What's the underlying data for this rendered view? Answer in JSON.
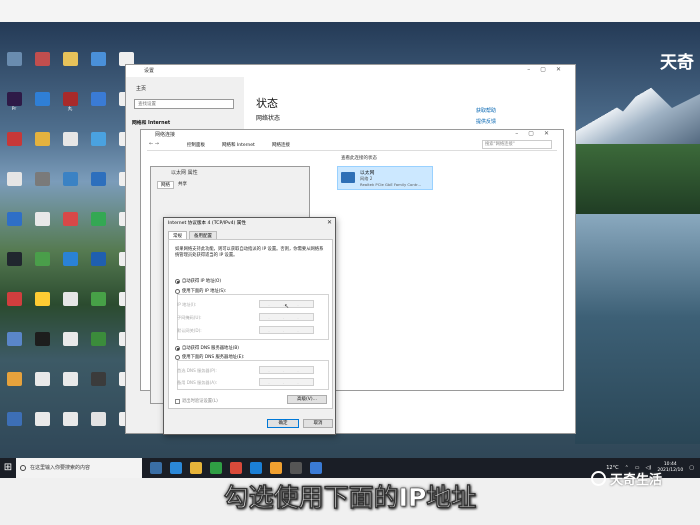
{
  "brand": {
    "top_right": "天奇",
    "bottom_right": "天奇生活"
  },
  "subtitle": "勾选使用下面的IP地址",
  "desktop_icons": [
    {
      "label": "",
      "color": "#6a8caf"
    },
    {
      "label": "",
      "color": "#c14e4e"
    },
    {
      "label": "",
      "color": "#e7c25a"
    },
    {
      "label": "",
      "color": "#4a90d9"
    },
    {
      "label": "",
      "color": "#efefef"
    },
    {
      "label": "Pr",
      "color": "#2e1a47"
    },
    {
      "label": "",
      "color": "#2f7fd6"
    },
    {
      "label": "丸",
      "color": "#a82a2a"
    },
    {
      "label": "",
      "color": "#3a7bd5"
    },
    {
      "label": "",
      "color": "#efefef"
    },
    {
      "label": "",
      "color": "#c73838"
    },
    {
      "label": "",
      "color": "#e4b23e"
    },
    {
      "label": "",
      "color": "#e6e6e6"
    },
    {
      "label": "",
      "color": "#4aa2e0"
    },
    {
      "label": "",
      "color": "#efefef"
    },
    {
      "label": "",
      "color": "#e5e5e5"
    },
    {
      "label": "",
      "color": "#7a7a7a"
    },
    {
      "label": "",
      "color": "#3b82c4"
    },
    {
      "label": "",
      "color": "#2d6fbd"
    },
    {
      "label": "",
      "color": "#efefef"
    },
    {
      "label": "",
      "color": "#2f6fc7"
    },
    {
      "label": "",
      "color": "#e8e8e8"
    },
    {
      "label": "",
      "color": "#d94848"
    },
    {
      "label": "",
      "color": "#34a853"
    },
    {
      "label": "",
      "color": "#efefef"
    },
    {
      "label": "",
      "color": "#20262e"
    },
    {
      "label": "",
      "color": "#4a9e4a"
    },
    {
      "label": "",
      "color": "#2a82d6"
    },
    {
      "label": "",
      "color": "#1f5fb0"
    },
    {
      "label": "",
      "color": "#efefef"
    },
    {
      "label": "",
      "color": "#d13e3e"
    },
    {
      "label": "",
      "color": "#ffcc33"
    },
    {
      "label": "",
      "color": "#e6e6e6"
    },
    {
      "label": "",
      "color": "#47a147"
    },
    {
      "label": "",
      "color": "#efefef"
    },
    {
      "label": "",
      "color": "#5a86c9"
    },
    {
      "label": "",
      "color": "#1d1d1d"
    },
    {
      "label": "",
      "color": "#e9e9e9"
    },
    {
      "label": "",
      "color": "#3b8c3b"
    },
    {
      "label": "",
      "color": "#efefef"
    },
    {
      "label": "",
      "color": "#e6a23c"
    },
    {
      "label": "",
      "color": "#e9e9e9"
    },
    {
      "label": "",
      "color": "#e9e9e9"
    },
    {
      "label": "",
      "color": "#3b3b3b"
    },
    {
      "label": "",
      "color": "#efefef"
    },
    {
      "label": "",
      "color": "#3d6fb6"
    },
    {
      "label": "",
      "color": "#e9e9e9"
    },
    {
      "label": "",
      "color": "#e9e9e9"
    },
    {
      "label": "",
      "color": "#e3e3e3"
    },
    {
      "label": "",
      "color": "#efefef"
    }
  ],
  "settings": {
    "title": "设置",
    "home": "主页",
    "search_placeholder": "查找设置",
    "category": "网络和 Internet",
    "heading": "状态",
    "subheading": "网络状态",
    "link_help": "获取帮助",
    "link_feedback": "提供反馈"
  },
  "network_connections": {
    "title": "网络连接",
    "breadcrumb": [
      "控制面板",
      "网络和 Internet",
      "网络连接"
    ],
    "search_placeholder": "搜索\"网络连接\"",
    "toolbar_item": "查看此连接的状态",
    "adapter": {
      "name": "以太网",
      "status": "网络 2",
      "device": "Realtek PCIe GbE Family Contr..."
    }
  },
  "ethernet_props": {
    "title": "以太网 属性",
    "tab_network": "网络",
    "tab_share": "共享"
  },
  "ipv4": {
    "title": "Internet 协议版本 4 (TCP/IPv4) 属性",
    "tab_general": "常规",
    "tab_alternate": "备用配置",
    "description": "如果网络支持此功能，则可以获取自动指派的 IP 设置。否则，你需要从网络系统管理员处获得适当的 IP 设置。",
    "auto_ip": "自动获得 IP 地址(O)",
    "manual_ip": "使用下面的 IP 地址(S):",
    "ip_label": "IP 地址(I):",
    "mask_label": "子网掩码(U):",
    "gateway_label": "默认网关(D):",
    "auto_dns": "自动获得 DNS 服务器地址(B)",
    "manual_dns": "使用下面的 DNS 服务器地址(E):",
    "dns1_label": "首选 DNS 服务器(P):",
    "dns2_label": "备用 DNS 服务器(A):",
    "validate": "退出时验证设置(L)",
    "advanced": "高级(V)...",
    "ok": "确定",
    "cancel": "取消",
    "selected_ip_mode": "auto",
    "selected_dns_mode": "auto",
    "empty_ip": ". . ."
  },
  "taskbar": {
    "search_text": "在这里输入你要搜索的内容",
    "temperature": "12°C",
    "time": "10:44",
    "date": "2021/12/10"
  }
}
